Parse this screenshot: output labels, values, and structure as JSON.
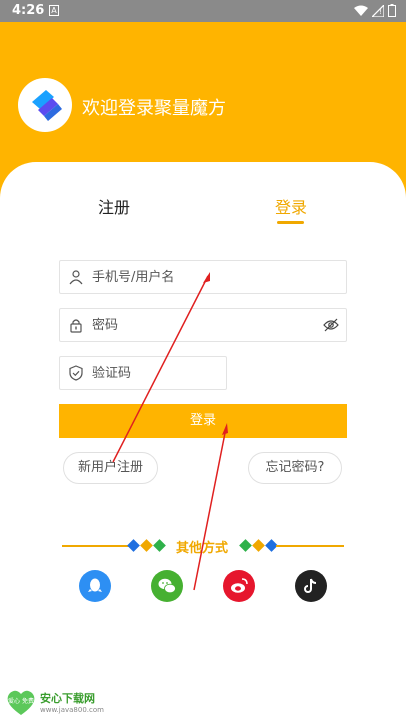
{
  "status_bar": {
    "time": "4:26",
    "notification": "A"
  },
  "header": {
    "welcome": "欢迎登录聚量魔方"
  },
  "tabs": {
    "register": "注册",
    "login": "登录"
  },
  "form": {
    "username_placeholder": "手机号/用户名",
    "password_placeholder": "密码",
    "code_placeholder": "验证码",
    "login_button": "登录"
  },
  "links": {
    "new_user": "新用户注册",
    "forgot": "忘记密码?"
  },
  "other_login": {
    "label": "其他方式",
    "providers": [
      "qq-icon",
      "wechat-icon",
      "weibo-icon",
      "douyin-icon"
    ]
  },
  "watermark": {
    "title": "安心下载网",
    "url": "www.java800.com",
    "badge": "爱心 免费"
  },
  "colors": {
    "accent": "#ffb400",
    "accent_text": "#f0a800",
    "diamond_blue": "#1f6fe0",
    "diamond_orange": "#f0a800",
    "diamond_green": "#2fb14a",
    "annotation_red": "#e02020"
  }
}
